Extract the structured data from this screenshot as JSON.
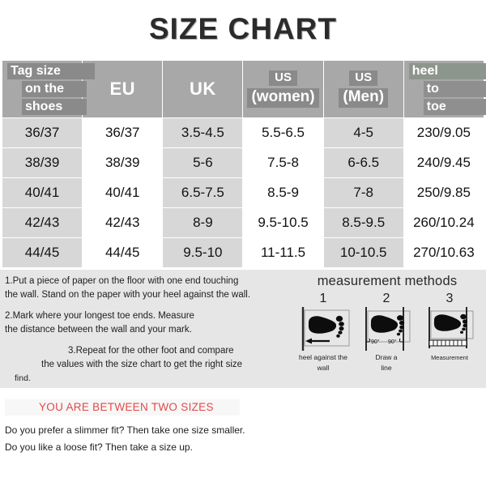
{
  "title": "SIZE CHART",
  "table": {
    "headers": [
      {
        "type": "stacked",
        "lines": [
          "Tag size",
          "on the",
          "shoes"
        ]
      },
      {
        "type": "plain",
        "label": "EU"
      },
      {
        "type": "plain",
        "label": "UK"
      },
      {
        "type": "two_line",
        "top": "US",
        "bottom": "(women)"
      },
      {
        "type": "two_line",
        "top": "US",
        "bottom": "(Men)"
      },
      {
        "type": "stacked",
        "lines": [
          "heel",
          "to",
          "toe"
        ]
      }
    ],
    "rows": [
      [
        "36/37",
        "36/37",
        "3.5-4.5",
        "5.5-6.5",
        "4-5",
        "230/9.05"
      ],
      [
        "38/39",
        "38/39",
        "5-6",
        "7.5-8",
        "6-6.5",
        "240/9.45"
      ],
      [
        "40/41",
        "40/41",
        "6.5-7.5",
        "8.5-9",
        "7-8",
        "250/9.85"
      ],
      [
        "42/43",
        "42/43",
        "8-9",
        "9.5-10.5",
        "8.5-9.5",
        "260/10.24"
      ],
      [
        "44/45",
        "44/45",
        "9.5-10",
        "11-11.5",
        "10-10.5",
        "270/10.63"
      ]
    ]
  },
  "instructions": {
    "step1_line1": "1.Put a piece of paper on the floor with one end touching",
    "step1_line2": "the wall. Stand on the paper with your heel against the wall.",
    "step2_line1": "2.Mark where your longest toe ends. Measure",
    "step2_line2": "the distance between the wall and your mark.",
    "step3_line1": "3.Repeat for the other foot and compare",
    "step3_line2": "the values with the size chart to get the right size",
    "step3_line3": "find."
  },
  "methods": {
    "title": "measurement methods",
    "items": [
      {
        "number": "1",
        "caption_line1": "heel against the",
        "caption_line2": "wall"
      },
      {
        "number": "2",
        "caption_line1": "Draw a",
        "caption_line2": "line",
        "angle_left": "90°",
        "angle_right": "90°"
      },
      {
        "number": "3",
        "caption_line1": "Measurement",
        "caption_line2": ""
      }
    ]
  },
  "bottom": {
    "headline": "YOU ARE BETWEEN TWO SIZES",
    "note1": "Do you prefer a slimmer fit? Then take one size smaller.",
    "note2": "Do you like a loose fit? Then take a size up."
  },
  "colors": {
    "header_bg": "#a8a8a8",
    "highlight": "#8a8a8a",
    "heel_highlight": "#8d968d",
    "row_shade": "#d7d7d7",
    "band_bg": "#e6e6e6",
    "accent_red": "#e04a4a"
  }
}
